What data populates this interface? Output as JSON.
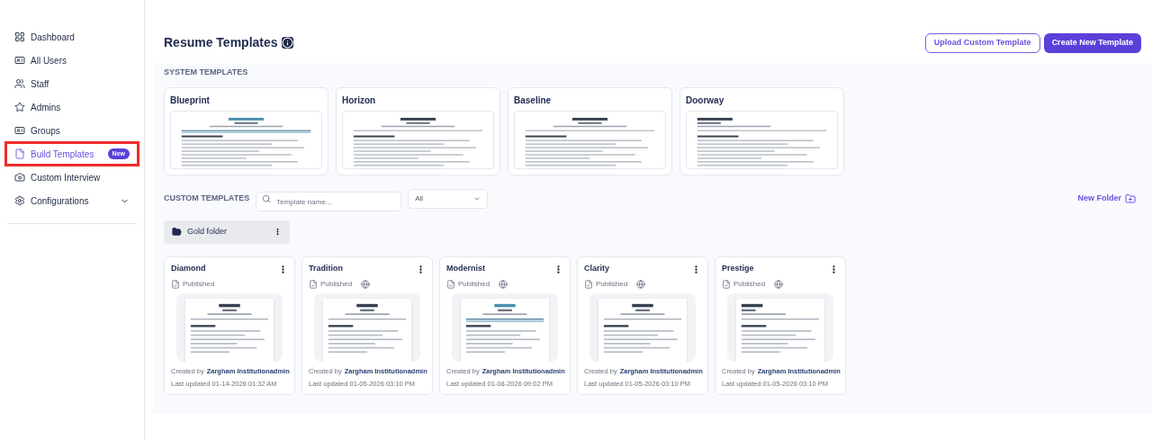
{
  "sidebar": {
    "items": [
      {
        "label": "Dashboard",
        "selected": false
      },
      {
        "label": "All Users",
        "selected": false
      },
      {
        "label": "Staff",
        "selected": false
      },
      {
        "label": "Admins",
        "selected": false
      },
      {
        "label": "Groups",
        "selected": false
      },
      {
        "label": "Build Templates",
        "selected": true,
        "badge": "New",
        "highlighted": true
      },
      {
        "label": "Custom Interview",
        "selected": false
      },
      {
        "label": "Configurations",
        "selected": false,
        "expandable": true
      }
    ]
  },
  "header": {
    "title": "Resume Templates",
    "buttons": [
      {
        "label": "Upload Custom Template",
        "kind": "outline"
      },
      {
        "label": "Create New Template",
        "kind": "primary"
      }
    ]
  },
  "system_templates": {
    "heading": "SYSTEM TEMPLATES",
    "items": [
      {
        "name": "Blueprint"
      },
      {
        "name": "Horizon"
      },
      {
        "name": "Baseline"
      },
      {
        "name": "Doorway"
      }
    ]
  },
  "custom_templates": {
    "heading": "CUSTOM TEMPLATES",
    "search": {
      "placeholder": "Template name..."
    },
    "filter": {
      "value": "All"
    },
    "new_folder": "New Folder",
    "folders": [
      {
        "name": "Gold folder"
      }
    ],
    "items": [
      {
        "name": "Diamond",
        "status": "Published",
        "shared": false,
        "created_prefix": "Created by",
        "author": "Zargham Institutionadmin",
        "updated": "Last updated 01-14-2026 01:32 AM"
      },
      {
        "name": "Tradition",
        "status": "Published",
        "shared": true,
        "created_prefix": "Created by",
        "author": "Zargham Institutionadmin",
        "updated": "Last updated 01-05-2026 03:10 PM"
      },
      {
        "name": "Modernist",
        "status": "Published",
        "shared": true,
        "created_prefix": "Created by",
        "author": "Zargham Institutionadmin",
        "updated": "Last updated 01-08-2026 09:02 PM"
      },
      {
        "name": "Clarity",
        "status": "Published",
        "shared": true,
        "created_prefix": "Created by",
        "author": "Zargham Institutionadmin",
        "updated": "Last updated 01-05-2026 03:10 PM"
      },
      {
        "name": "Prestige",
        "status": "Published",
        "shared": true,
        "created_prefix": "Created by",
        "author": "Zargham Institutionadmin",
        "updated": "Last updated 01-05-2026 03:10 PM"
      }
    ]
  }
}
